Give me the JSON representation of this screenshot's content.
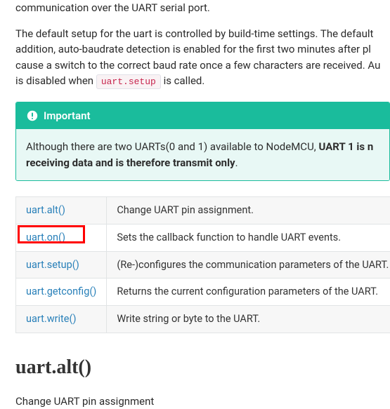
{
  "intro": {
    "line1": "communication over the UART serial port.",
    "p2_part1": "The default setup for the uart is controlled by build-time settings. The default",
    "p2_part2": "addition, auto-baudrate detection is enabled for the first two minutes after pl",
    "p2_part3": "cause a switch to the correct baud rate once a few characters are received. Au",
    "p2_part4_prefix": "is disabled when ",
    "p2_code": "uart.setup",
    "p2_part4_suffix": " is called."
  },
  "callout": {
    "title": "Important",
    "body_prefix": "Although there are two UARTs(0 and 1) available to NodeMCU, ",
    "body_bold1": "UART 1 is n",
    "body_bold2": "receiving data and is therefore transmit only",
    "body_suffix": "."
  },
  "api_table": [
    {
      "fn": "uart.alt()",
      "desc": "Change UART pin assignment."
    },
    {
      "fn": "uart.on()",
      "desc": "Sets the callback function to handle UART events."
    },
    {
      "fn": "uart.setup()",
      "desc": "(Re-)configures the communication parameters of the UART."
    },
    {
      "fn": "uart.getconfig()",
      "desc": "Returns the current configuration parameters of the UART."
    },
    {
      "fn": "uart.write()",
      "desc": "Write string or byte to the UART."
    }
  ],
  "section": {
    "title": "uart.alt()",
    "lead": "Change UART pin assignment"
  }
}
